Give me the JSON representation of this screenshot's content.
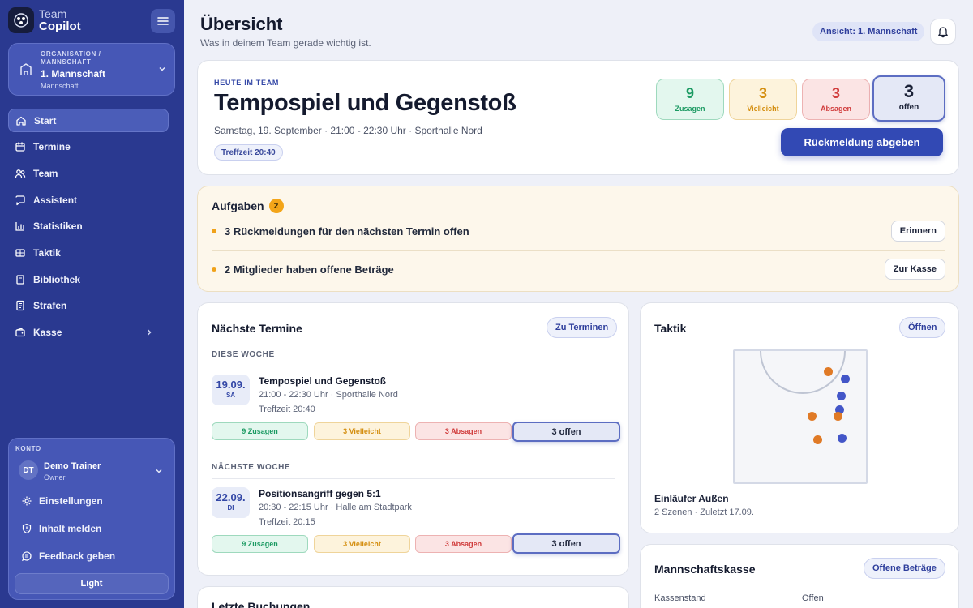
{
  "brand": {
    "line1": "Team",
    "line2": "Copilot"
  },
  "org": {
    "eyebrow": "ORGANISATION / MANNSCHAFT",
    "name": "1. Mannschaft",
    "sub": "Mannschaft"
  },
  "nav": [
    {
      "label": "Start",
      "icon": "home-icon",
      "active": true
    },
    {
      "label": "Termine",
      "icon": "calendar-icon"
    },
    {
      "label": "Team",
      "icon": "users-icon"
    },
    {
      "label": "Assistent",
      "icon": "chat-icon"
    },
    {
      "label": "Statistiken",
      "icon": "chart-icon"
    },
    {
      "label": "Taktik",
      "icon": "board-icon"
    },
    {
      "label": "Bibliothek",
      "icon": "book-icon"
    },
    {
      "label": "Strafen",
      "icon": "document-icon"
    },
    {
      "label": "Kasse",
      "icon": "wallet-icon"
    }
  ],
  "account": {
    "eyebrow": "KONTO",
    "initials": "DT",
    "name": "Demo Trainer",
    "role": "Owner",
    "settings": "Einstellungen",
    "report": "Inhalt melden",
    "feedback": "Feedback geben",
    "theme": "Light"
  },
  "header": {
    "title": "Übersicht",
    "subtitle": "Was in deinem Team gerade wichtig ist.",
    "view": "Ansicht: 1. Mannschaft"
  },
  "hero": {
    "eyebrow": "HEUTE IM TEAM",
    "title": "Tempospiel und Gegenstoß",
    "meta": "Samstag, 19. September · 21:00 - 22:30 Uhr · Sporthalle Nord",
    "tag": "Treffzeit 20:40",
    "stats": {
      "yes": {
        "n": "9",
        "l": "Zusagen"
      },
      "maybe": {
        "n": "3",
        "l": "Vielleicht"
      },
      "no": {
        "n": "3",
        "l": "Absagen"
      },
      "open": {
        "n": "3",
        "l": "offen"
      }
    },
    "cta": "Rückmeldung abgeben"
  },
  "tasks": {
    "title": "Aufgaben",
    "count": "2",
    "items": [
      {
        "text": "3 Rückmeldungen für den nächsten Termin offen",
        "action": "Erinnern"
      },
      {
        "text": "2 Mitglieder haben offene Beträge",
        "action": "Zur Kasse"
      }
    ]
  },
  "events": {
    "title": "Nächste Termine",
    "action": "Zu Terminen",
    "groups": [
      {
        "label": "DIESE WOCHE",
        "date": "19.09.",
        "weekday": "SA",
        "title": "Tempospiel und Gegenstoß",
        "time": "21:00 - 22:30 Uhr · Sporthalle Nord",
        "meet": "Treffzeit 20:40",
        "yes": "9 Zusagen",
        "maybe": "3 Vielleicht",
        "no": "3 Absagen",
        "open": "3 offen"
      },
      {
        "label": "NÄCHSTE WOCHE",
        "date": "22.09.",
        "weekday": "DI",
        "title": "Positionsangriff gegen 5:1",
        "time": "20:30 - 22:15 Uhr · Halle am Stadtpark",
        "meet": "Treffzeit 20:15",
        "yes": "9 Zusagen",
        "maybe": "3 Vielleicht",
        "no": "3 Absagen",
        "open": "3 offen"
      }
    ]
  },
  "tactic": {
    "title": "Taktik",
    "action": "Öffnen",
    "name": "Einläufer Außen",
    "meta": "2 Szenen · Zuletzt 17.09."
  },
  "bookings": {
    "title": "Letzte Buchungen"
  },
  "cash": {
    "title": "Mannschaftskasse",
    "action": "Offene Beträge",
    "balance_label": "Kassenstand",
    "open_label": "Offen"
  },
  "colors": {
    "sidebar": "#2a3990",
    "accent": "#3249b4",
    "yes": "#1b9a62",
    "maybe": "#d48e0f",
    "no": "#d03b3b"
  }
}
